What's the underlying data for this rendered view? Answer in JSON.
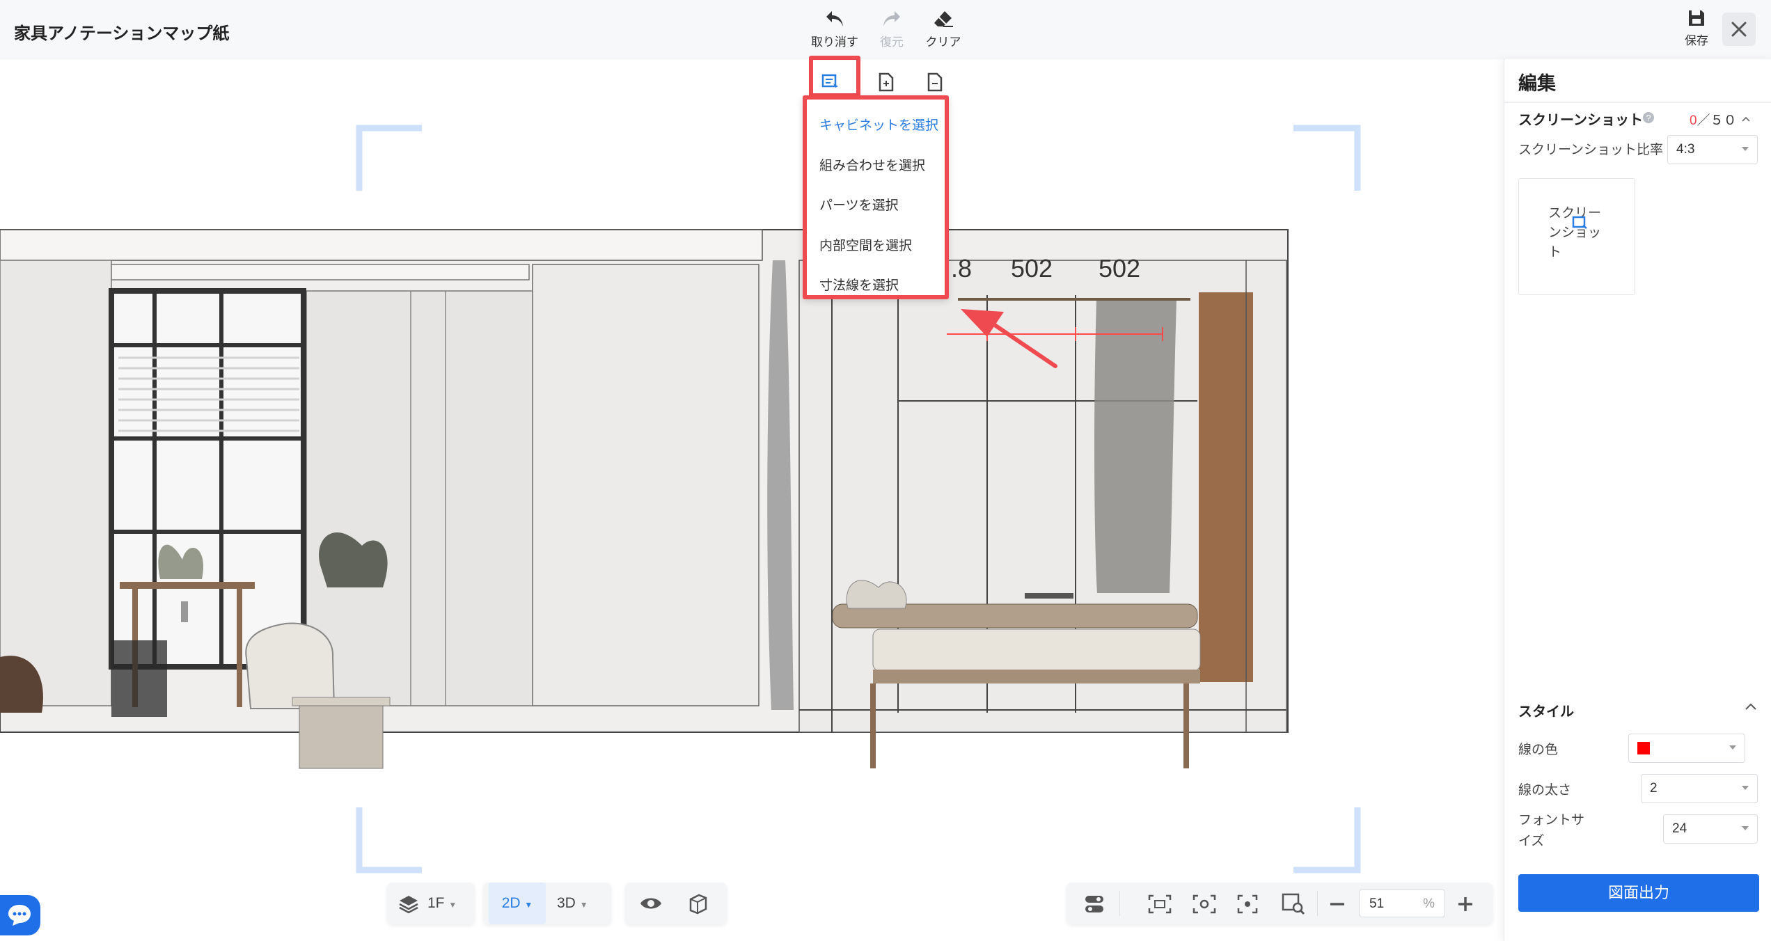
{
  "app": {
    "title": "家具アノテーションマップ紙"
  },
  "toolbar": {
    "undo_label": "取り消す",
    "redo_label": "復元",
    "clear_label": "クリア",
    "save_label": "保存"
  },
  "selection_menu": {
    "items": [
      {
        "label": "キャビネットを選択",
        "active": true
      },
      {
        "label": "組み合わせを選択",
        "active": false
      },
      {
        "label": "パーツを選択",
        "active": false
      },
      {
        "label": "内部空間を選択",
        "active": false
      },
      {
        "label": "寸法線を選択",
        "active": false
      }
    ]
  },
  "drawing": {
    "dimension_labels": [
      ".8",
      "502",
      "502"
    ]
  },
  "panel": {
    "title": "編集",
    "screenshot": {
      "label": "スクリーンショット",
      "count_current": "0",
      "count_total": "５０",
      "ratio_label": "スクリーンショット比率",
      "ratio_value": "4:3",
      "card_label": "スクリーンショット"
    },
    "style": {
      "label": "スタイル",
      "line_color_label": "線の色",
      "line_color": "#ff0000",
      "line_width_label": "線の太さ",
      "line_width_value": "2",
      "font_size_label": "フォントサイズ",
      "font_size_value": "24"
    },
    "export_label": "図面出力"
  },
  "bottom": {
    "floor_label": "1F",
    "view_2d": "2D",
    "view_3d": "3D",
    "zoom_value": "51",
    "zoom_unit": "%"
  },
  "colors": {
    "accent": "#1e6fe8",
    "highlight": "#ef4a4f",
    "corner_marks": "#cfe0fb"
  }
}
